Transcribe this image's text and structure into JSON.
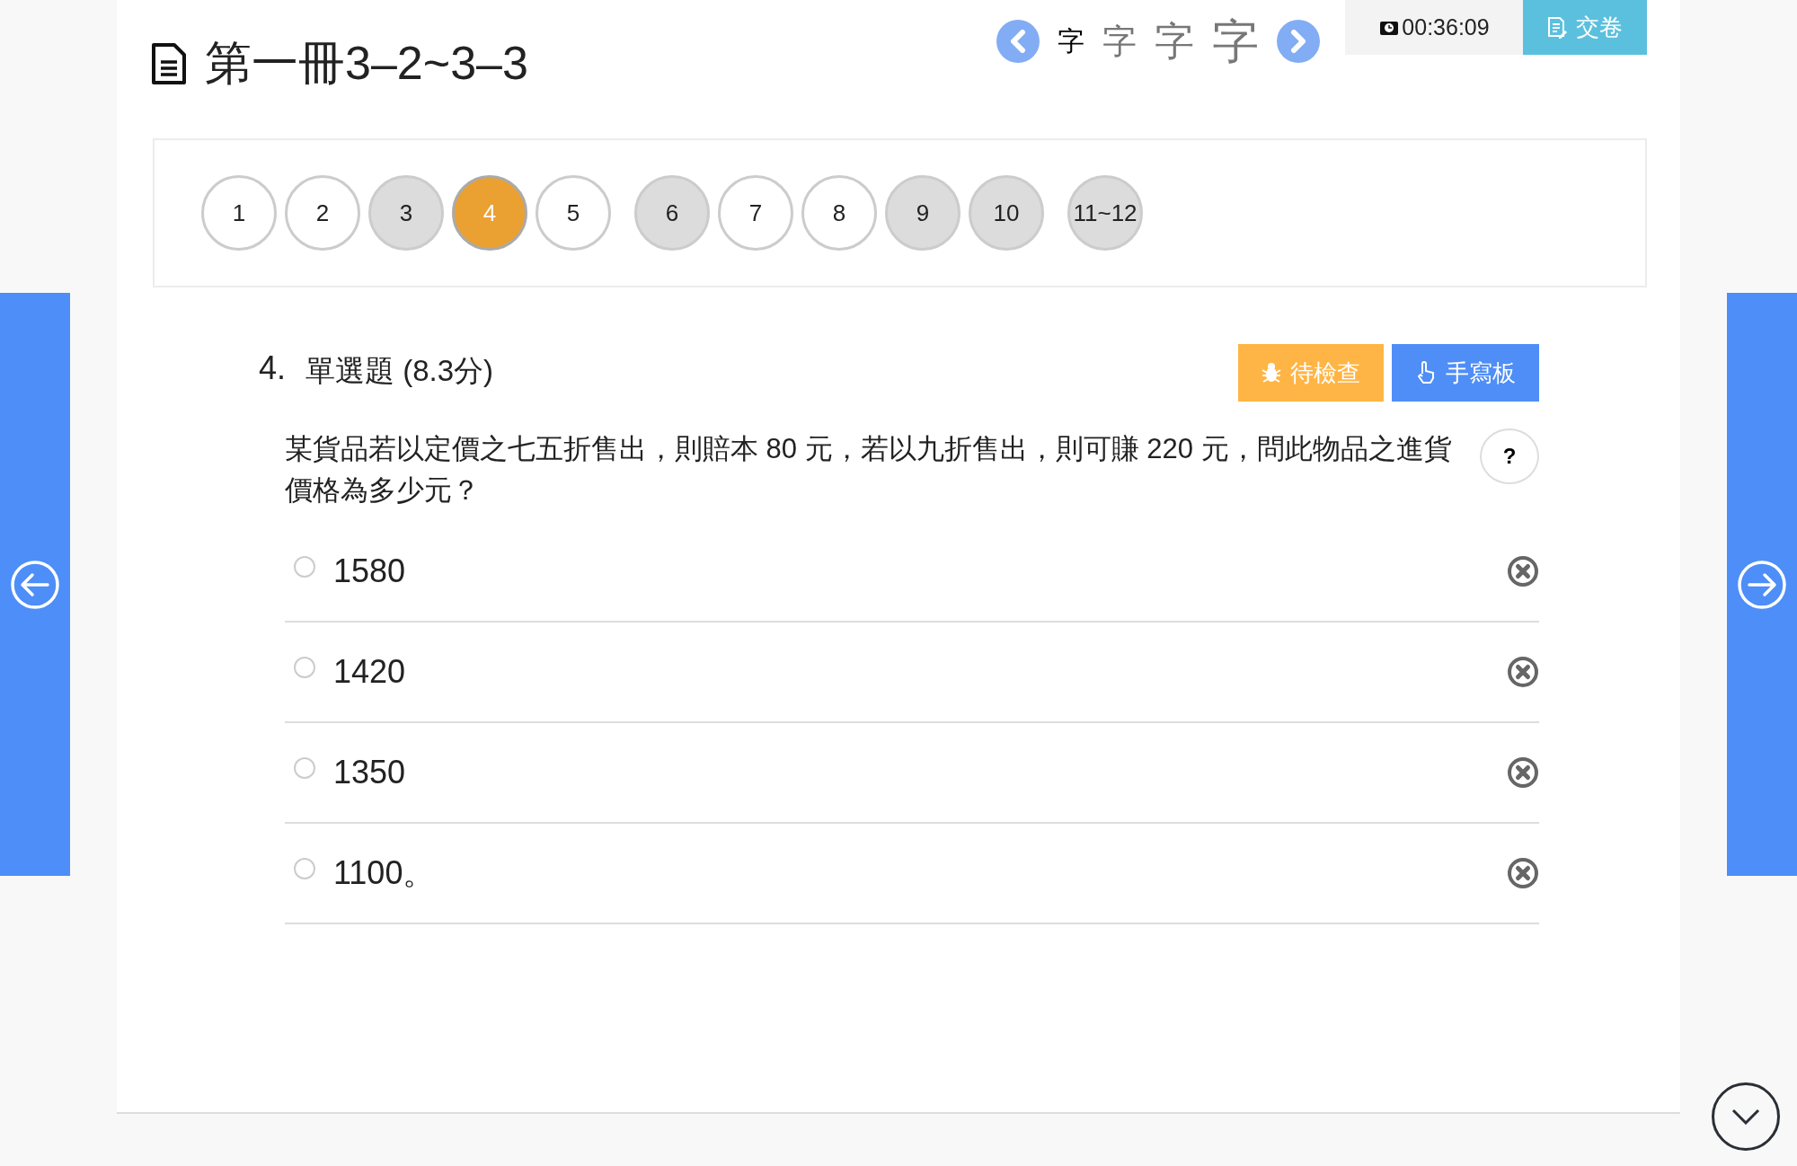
{
  "title": "第一冊3–2~3–3",
  "font_sizes": [
    {
      "label": "字",
      "selected": true
    },
    {
      "label": "字",
      "selected": false
    },
    {
      "label": "字",
      "selected": false
    },
    {
      "label": "字",
      "selected": false
    }
  ],
  "timer": "00:36:09",
  "submit_button": "交卷",
  "question_nav": {
    "groups": [
      {
        "items": [
          {
            "label": "1",
            "answered": false,
            "selected": false
          },
          {
            "label": "2",
            "answered": false,
            "selected": false
          },
          {
            "label": "3",
            "answered": true,
            "selected": false
          },
          {
            "label": "4",
            "answered": false,
            "selected": true
          },
          {
            "label": "5",
            "answered": false,
            "selected": false
          }
        ]
      },
      {
        "items": [
          {
            "label": "6",
            "answered": true,
            "selected": false
          },
          {
            "label": "7",
            "answered": false,
            "selected": false
          },
          {
            "label": "8",
            "answered": false,
            "selected": false
          },
          {
            "label": "9",
            "answered": true,
            "selected": false
          },
          {
            "label": "10",
            "answered": true,
            "selected": false
          }
        ]
      },
      {
        "items": [
          {
            "label": "11~12",
            "answered": true,
            "selected": false
          }
        ]
      }
    ]
  },
  "question": {
    "number": "4.",
    "type_score": "單選題 (8.3分)",
    "buttons": [
      {
        "kind": "review",
        "label": "待檢查"
      },
      {
        "kind": "handwriting",
        "label": "手寫板"
      }
    ],
    "help_button": "?",
    "text": "某貨品若以定價之七五折售出，則賠本 80 元，若以九折售出，則可賺 220 元，問此物品之進貨價格為多少元？",
    "options": [
      {
        "text": "1580",
        "selected": false
      },
      {
        "text": "1420",
        "selected": false
      },
      {
        "text": "1350",
        "selected": false
      },
      {
        "text": "1100。",
        "selected": false
      }
    ]
  }
}
